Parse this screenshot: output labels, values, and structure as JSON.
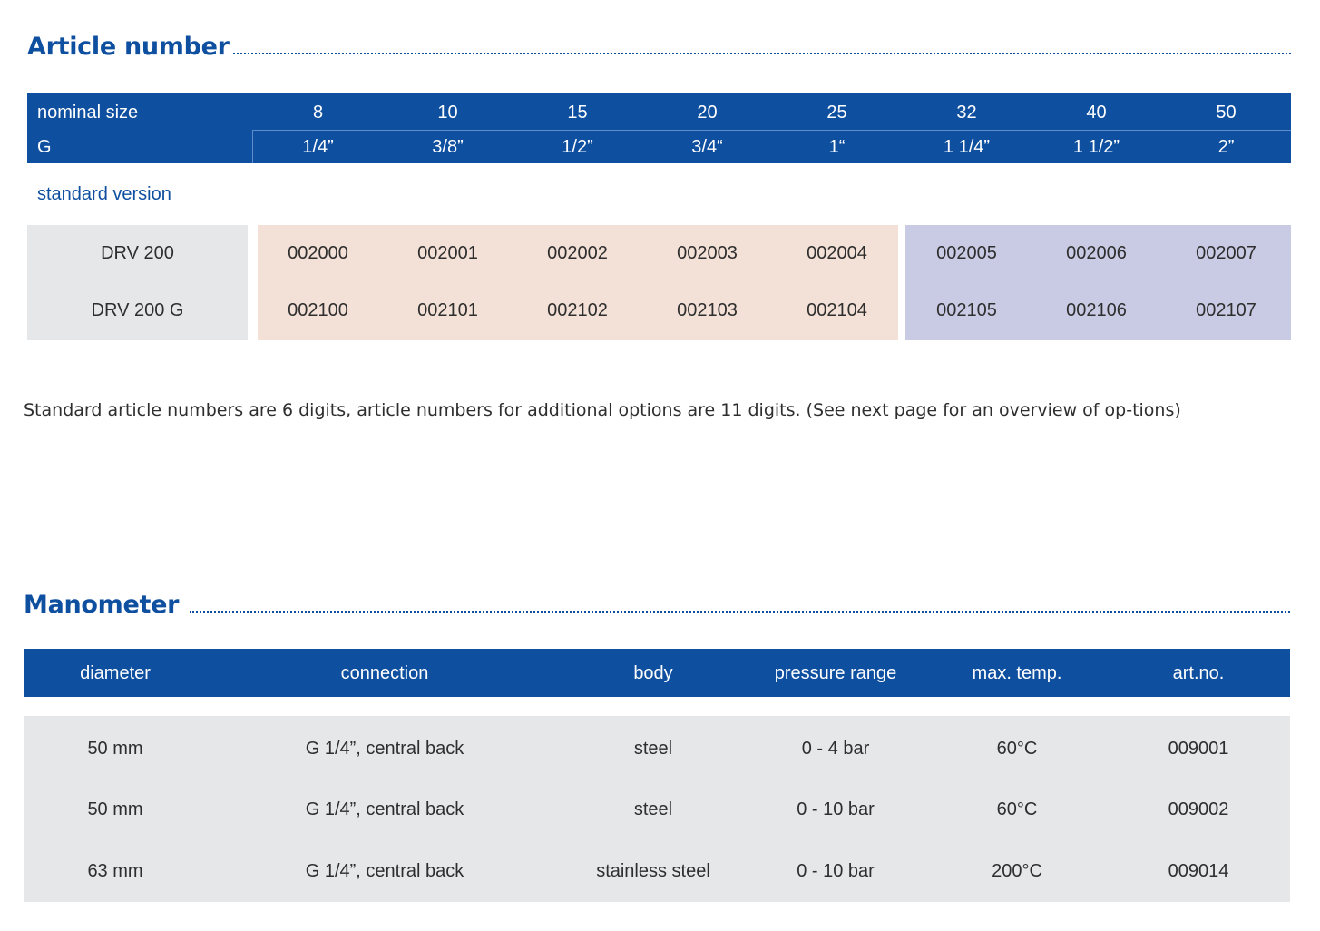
{
  "article_section": {
    "title": "Article number",
    "header": {
      "row1_label": "nominal size",
      "nominal_sizes": [
        "8",
        "10",
        "15",
        "20",
        "25",
        "32",
        "40",
        "50"
      ],
      "row2_label": "G",
      "thread_sizes": [
        "1/4”",
        "3/8”",
        "1/2”",
        "3/4“",
        "1“",
        "1 1/4”",
        "1 1/2”",
        "2”"
      ]
    },
    "subtitle": "standard version",
    "rows": [
      {
        "label": "DRV 200",
        "numbers": [
          "002000",
          "002001",
          "002002",
          "002003",
          "002004",
          "002005",
          "002006",
          "002007"
        ]
      },
      {
        "label": "DRV 200 G",
        "numbers": [
          "002100",
          "002101",
          "002102",
          "002103",
          "002104",
          "002105",
          "002106",
          "002107"
        ]
      }
    ],
    "note": "Standard article numbers are 6 digits, article numbers for additional options are 11 digits. (See next page for an overview of op-tions)"
  },
  "manometer_section": {
    "title": "Manometer",
    "columns": [
      "diameter",
      "connection",
      "body",
      "pressure range",
      "max. temp.",
      "art.no."
    ],
    "rows": [
      [
        "50 mm",
        "G 1/4”, central back",
        "steel",
        "0 - 4 bar",
        "60°C",
        "009001"
      ],
      [
        "50 mm",
        "G 1/4”, central back",
        "steel",
        "0 - 10 bar",
        "60°C",
        "009002"
      ],
      [
        "63 mm",
        "G 1/4”, central back",
        "stainless steel",
        "0 - 10 bar",
        "200°C",
        "009014"
      ]
    ]
  },
  "colors": {
    "brand_blue": "#0e4fa0",
    "row_grey": "#e6e7e9",
    "group_peach": "#f3e0d6",
    "group_lavender": "#c9cbe5"
  }
}
